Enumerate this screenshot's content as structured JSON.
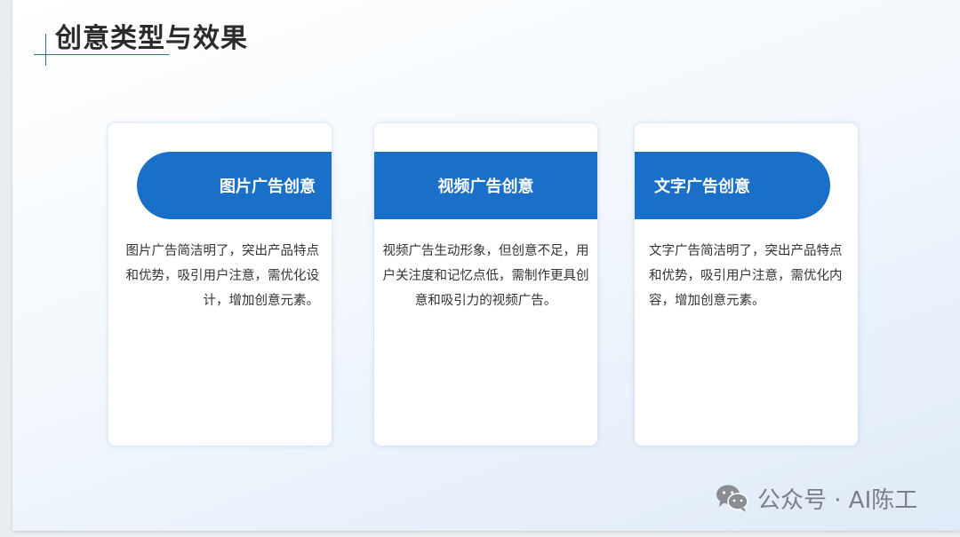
{
  "slide": {
    "title": "创意类型与效果"
  },
  "cards": [
    {
      "heading": "图片广告创意",
      "body": "图片广告简洁明了，突出产品特点和优势，吸引用户注意，需优化设计，增加创意元素。"
    },
    {
      "heading": "视频广告创意",
      "body": "视频广告生动形象，但创意不足，用户关注度和记忆点低，需制作更具创意和吸引力的视频广告。"
    },
    {
      "heading": "文字广告创意",
      "body": "文字广告简洁明了，突出产品特点和优势，吸引用户注意，需优化内容，增加创意元素。"
    }
  ],
  "watermark": {
    "icon": "wechat-icon",
    "text": "公众号 · AI陈工"
  },
  "colors": {
    "accent": "#1a6fc9",
    "title": "#2b2b2b",
    "body_text": "#333333",
    "watermark": "#7b7f86"
  }
}
